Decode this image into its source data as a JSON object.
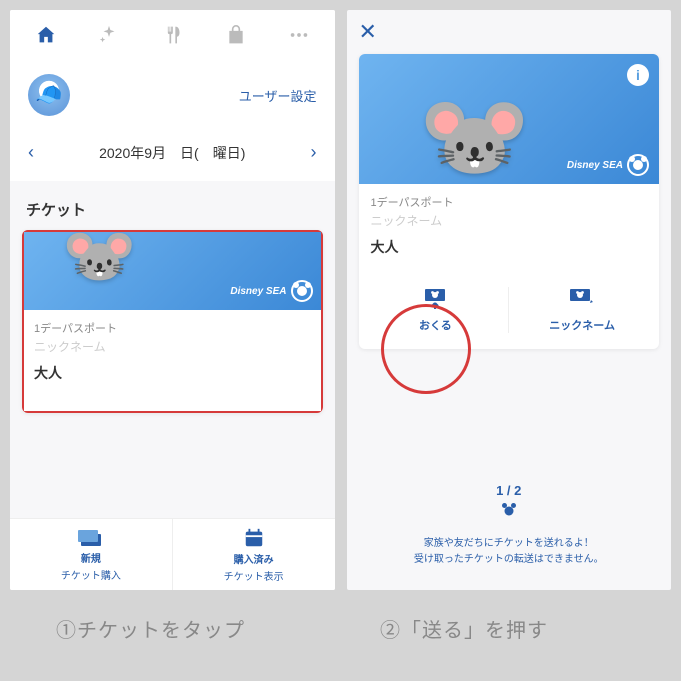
{
  "left": {
    "user_settings": "ユーザー設定",
    "date": "2020年9月　日(　曜日)",
    "section_title": "チケット",
    "ticket": {
      "sub": "1デーパスポート",
      "nick": "ニックネーム",
      "type": "大人",
      "park": "Disney SEA"
    },
    "bottom": {
      "buy": {
        "l1": "新規",
        "l2": "チケット購入"
      },
      "show": {
        "l1": "購入済み",
        "l2": "チケット表示"
      }
    }
  },
  "right": {
    "ticket": {
      "sub": "1デーパスポート",
      "nick": "ニックネーム",
      "type": "大人",
      "park": "Disney SEA"
    },
    "actions": {
      "send": "おくる",
      "nick": "ニックネーム"
    },
    "pager": "1 / 2",
    "notice1": "家族や友だちにチケットを送れるよ！",
    "notice2": "受け取ったチケットの転送はできません。"
  },
  "captions": {
    "c1": "①チケットをタップ",
    "c2": "②「送る」を押す"
  }
}
